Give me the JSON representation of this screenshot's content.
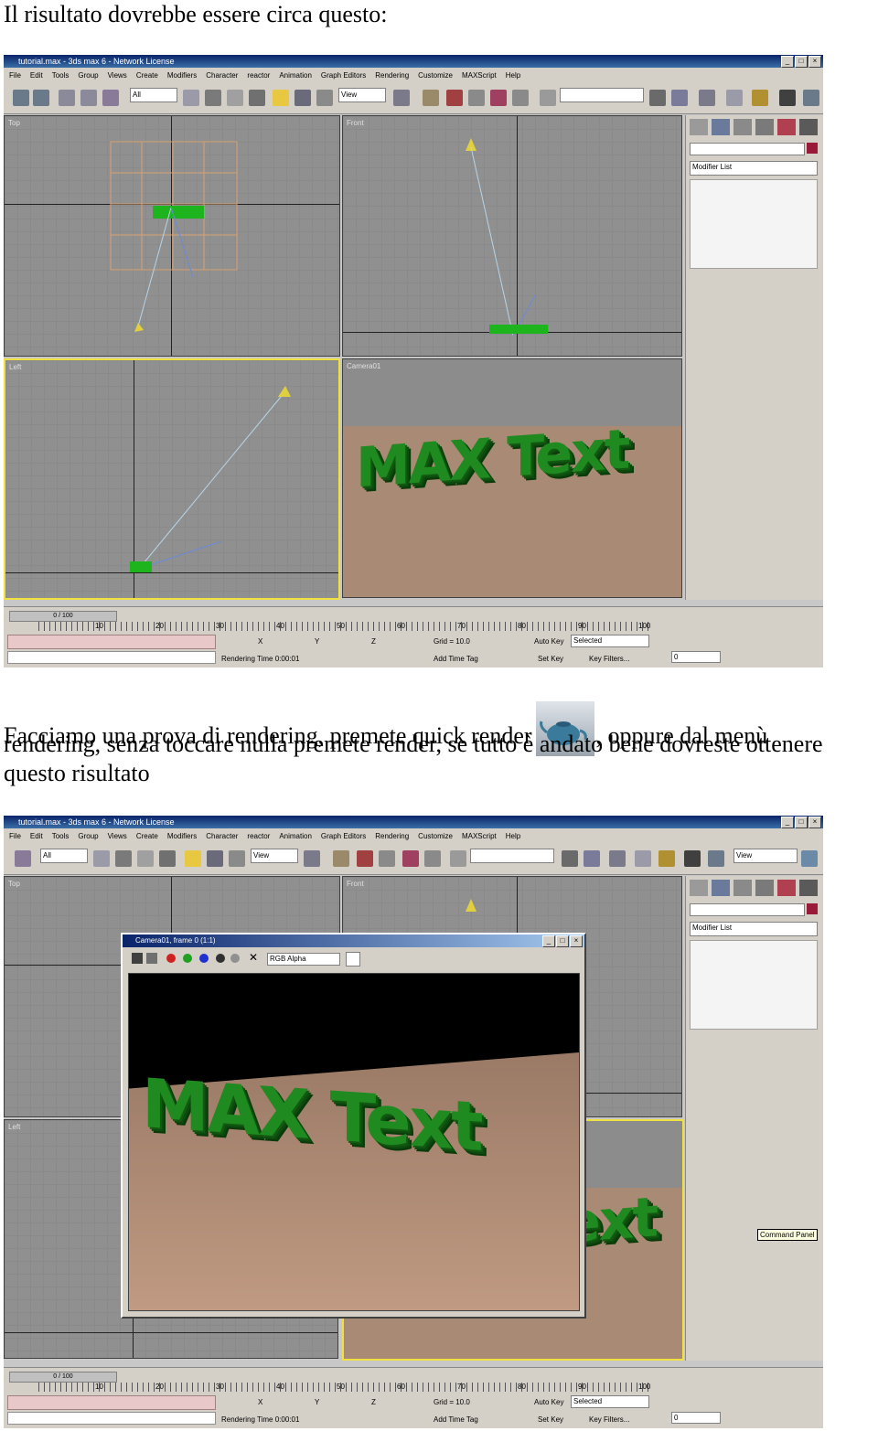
{
  "doc": {
    "line1": "Il risultato dovrebbe essere circa questo:",
    "para_a": "Facciamo una prova di rendering, premete quick render",
    "para_b": ", oppure dal menù",
    "para_c": "rendering, senza toccare nulla premete render, se tutto è andato bene dovreste ottenere",
    "para_d": "questo risultato"
  },
  "app": {
    "title": "tutorial.max - 3ds max 6 - Network License",
    "menu": [
      "File",
      "Edit",
      "Tools",
      "Group",
      "Views",
      "Create",
      "Modifiers",
      "Character",
      "reactor",
      "Animation",
      "Graph Editors",
      "Rendering",
      "Customize",
      "MAXScript",
      "Help"
    ],
    "selection_filter": "All",
    "ref_coord": "View",
    "viewports": {
      "top": "Top",
      "front": "Front",
      "left": "Left",
      "camera": "Camera01"
    },
    "modifier_list": "Modifier List",
    "time_slider": "0 / 100",
    "tick_labels": [
      "10",
      "20",
      "30",
      "40",
      "50",
      "60",
      "70",
      "80",
      "90",
      "100"
    ],
    "status": {
      "x_label": "X",
      "y_label": "Y",
      "z_label": "Z",
      "grid": "Grid = 10.0",
      "rendering_time": "Rendering Time  0:00:01",
      "add_time_tag": "Add Time Tag",
      "auto_key": "Auto Key",
      "set_key": "Set Key",
      "selected": "Selected",
      "key_filters": "Key Filters...",
      "frame": "0"
    },
    "scene_text": "MAX Text"
  },
  "render_window": {
    "title": "Camera01, frame 0 (1:1)",
    "channel": "RGB Alpha"
  },
  "tooltip": "Command Panel"
}
